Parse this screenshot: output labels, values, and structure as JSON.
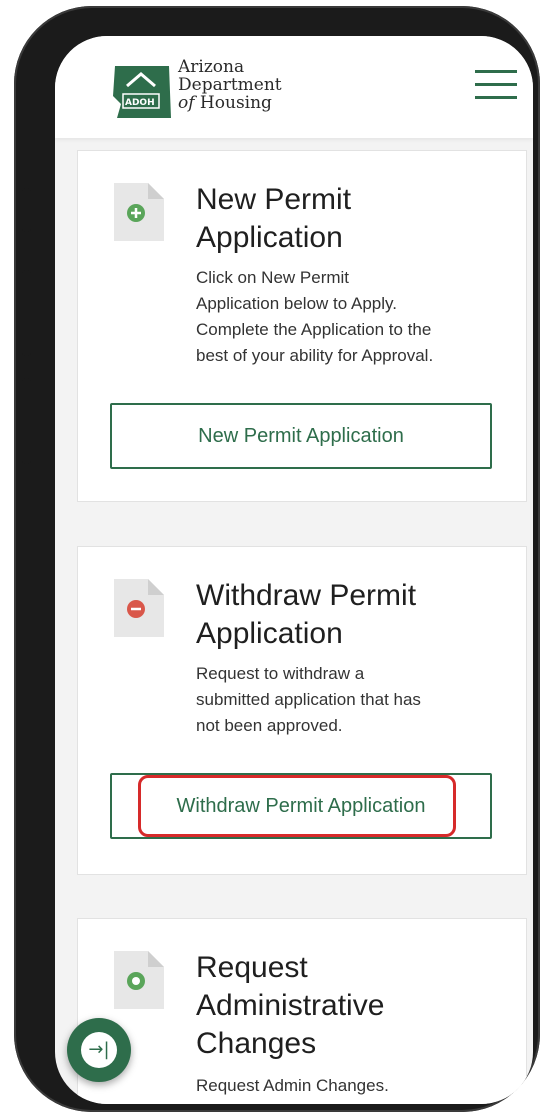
{
  "header": {
    "logo_text": "ADOH",
    "org_name_line1": "Arizona",
    "org_name_line2": "Department",
    "org_name_line3_italic": "of",
    "org_name_line3": " Housing",
    "menu_icon": "hamburger-menu-icon"
  },
  "cards": [
    {
      "icon": "add-document-icon",
      "icon_color": "#5aa55a",
      "title_line1": "New Permit",
      "title_line2": "Application",
      "description_lines": [
        "Click on New Permit",
        "Application below to Apply.",
        "Complete the Application to the",
        "best of your ability for Approval."
      ],
      "button_label": "New Permit Application"
    },
    {
      "icon": "remove-document-icon",
      "icon_color": "#d9574a",
      "title_line1": "Withdraw Permit",
      "title_line2": "Application",
      "description_lines": [
        "Request to withdraw a",
        "submitted application that has",
        "not been approved."
      ],
      "button_label": "Withdraw Permit Application"
    },
    {
      "icon": "circle-document-icon",
      "icon_color": "#5aa55a",
      "title_line1": "Request",
      "title_line2": "Administrative",
      "title_line3": "Changes",
      "description_lines": [
        "Request Admin Changes."
      ]
    }
  ],
  "fab": {
    "icon": "collapse-arrow-icon",
    "glyph": "→|"
  },
  "colors": {
    "brand_green": "#2e6d4b",
    "highlight_red": "#d62a2a"
  }
}
